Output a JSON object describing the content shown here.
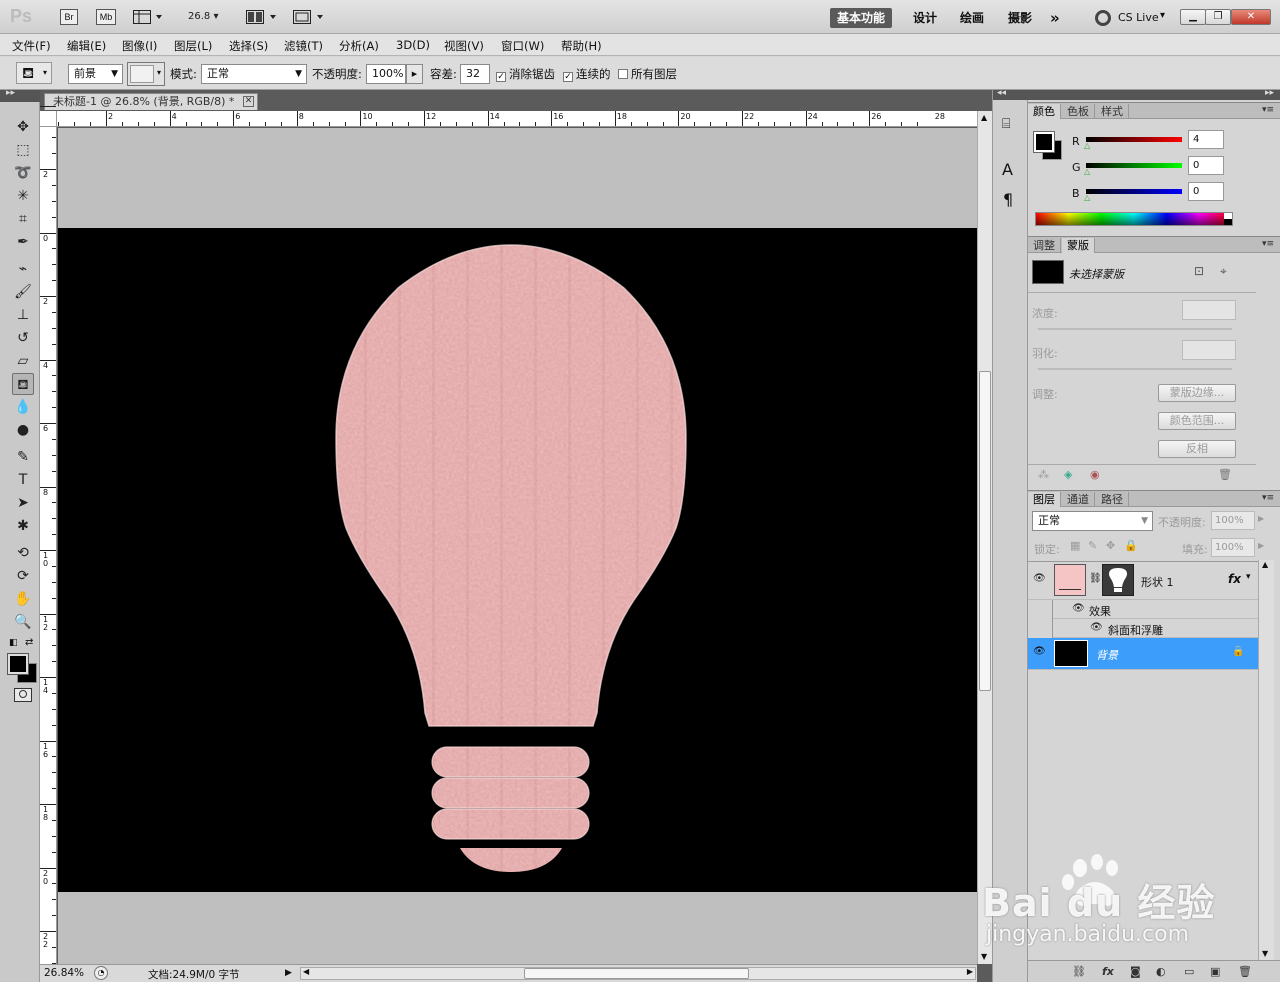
{
  "appbar": {
    "logo": "Ps",
    "bridge": "Br",
    "minibridge": "Mb",
    "zoom": "26.8",
    "workspaces": [
      "基本功能",
      "设计",
      "绘画",
      "摄影"
    ],
    "more": "»",
    "cslive": "CS Live"
  },
  "menu": [
    "文件(F)",
    "编辑(E)",
    "图像(I)",
    "图层(L)",
    "选择(S)",
    "滤镜(T)",
    "分析(A)",
    "3D(D)",
    "视图(V)",
    "窗口(W)",
    "帮助(H)"
  ],
  "options": {
    "fill_source": "前景",
    "mode_label": "模式:",
    "mode_value": "正常",
    "opacity_label": "不透明度:",
    "opacity_value": "100%",
    "tolerance_label": "容差:",
    "tolerance_value": "32",
    "antialias_label": "消除锯齿",
    "contiguous_label": "连续的",
    "alllayers_label": "所有图层"
  },
  "document": {
    "tab_title": "未标题-1 @ 26.8% (背景, RGB/8) *",
    "ruler_h": [
      "2",
      "4",
      "6",
      "8",
      "10",
      "12",
      "14",
      "16",
      "18",
      "20",
      "22",
      "24",
      "26",
      "28"
    ],
    "ruler_v": [
      "2",
      "0",
      "2",
      "4",
      "6",
      "8",
      "1\n0",
      "1\n2",
      "1\n4",
      "1\n6",
      "1\n8",
      "2\n0",
      "2\n2"
    ],
    "zoom_status": "26.84%",
    "doc_info": "文档:24.9M/0 字节"
  },
  "colors": {
    "accent": "#3d9dfa",
    "bulb_fill": "#f3bcbc",
    "canvas_black": "#000000",
    "pasteboard": "#bfbfbf"
  },
  "color_panel": {
    "tabs": [
      "颜色",
      "色板",
      "样式"
    ],
    "r_label": "R",
    "g_label": "G",
    "b_label": "B",
    "r": "4",
    "g": "0",
    "b": "0"
  },
  "masks_panel": {
    "tabs": [
      "调整",
      "蒙版"
    ],
    "title": "未选择蒙版",
    "density_label": "浓度:",
    "feather_label": "羽化:",
    "refine_label": "调整:",
    "btn_edge": "蒙版边缘...",
    "btn_range": "颜色范围...",
    "btn_invert": "反相"
  },
  "layers_panel": {
    "tabs": [
      "图层",
      "通道",
      "路径"
    ],
    "blend_mode": "正常",
    "opacity_label": "不透明度:",
    "opacity_value": "100%",
    "lock_label": "锁定:",
    "fill_label": "填充:",
    "fill_value": "100%",
    "layers": [
      {
        "name": "形状 1",
        "fx": "fx"
      },
      {
        "name": "效果"
      },
      {
        "name": "斜面和浮雕"
      },
      {
        "name": "背景"
      }
    ]
  },
  "watermark": {
    "brand": "Bai du 经验",
    "url": "jingyan.baidu.com"
  }
}
